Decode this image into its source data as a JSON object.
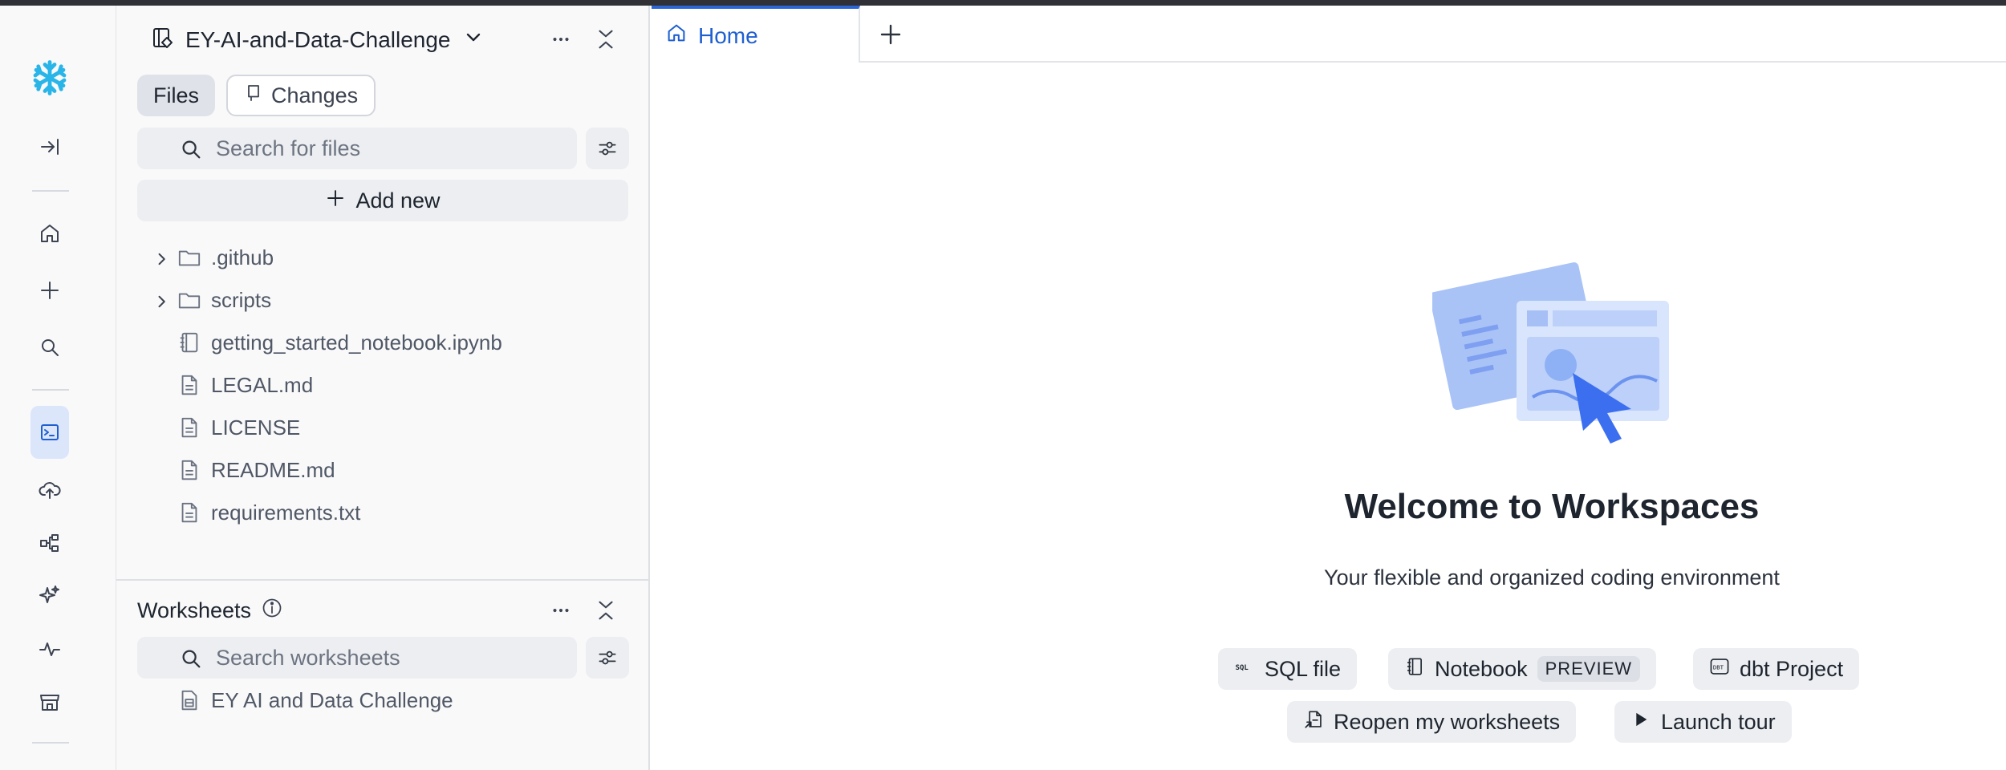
{
  "sidebar": {
    "workspace_name": "EY-AI-and-Data-Challenge",
    "tabs": {
      "files": "Files",
      "changes": "Changes"
    },
    "file_search_placeholder": "Search for files",
    "add_new": "Add new",
    "tree": [
      {
        "name": ".github",
        "type": "folder"
      },
      {
        "name": "scripts",
        "type": "folder"
      },
      {
        "name": "getting_started_notebook.ipynb",
        "type": "notebook"
      },
      {
        "name": "LEGAL.md",
        "type": "file"
      },
      {
        "name": "LICENSE",
        "type": "file"
      },
      {
        "name": "README.md",
        "type": "file"
      },
      {
        "name": "requirements.txt",
        "type": "file"
      }
    ],
    "worksheets": {
      "title": "Worksheets",
      "search_placeholder": "Search worksheets",
      "items": [
        {
          "name": "EY AI and Data Challenge"
        }
      ]
    }
  },
  "main": {
    "tabs": [
      {
        "label": "Home"
      }
    ],
    "welcome": {
      "title": "Welcome to Workspaces",
      "subtitle": "Your flexible and organized coding environment"
    },
    "actions": {
      "sql_file": "SQL file",
      "notebook": "Notebook",
      "notebook_badge": "PREVIEW",
      "dbt_project": "dbt Project",
      "reopen": "Reopen my worksheets",
      "launch_tour": "Launch tour"
    }
  },
  "icons": {
    "logo": "snowflake-icon",
    "accent": "#2a66d6",
    "logo_color": "#29b5e8"
  }
}
